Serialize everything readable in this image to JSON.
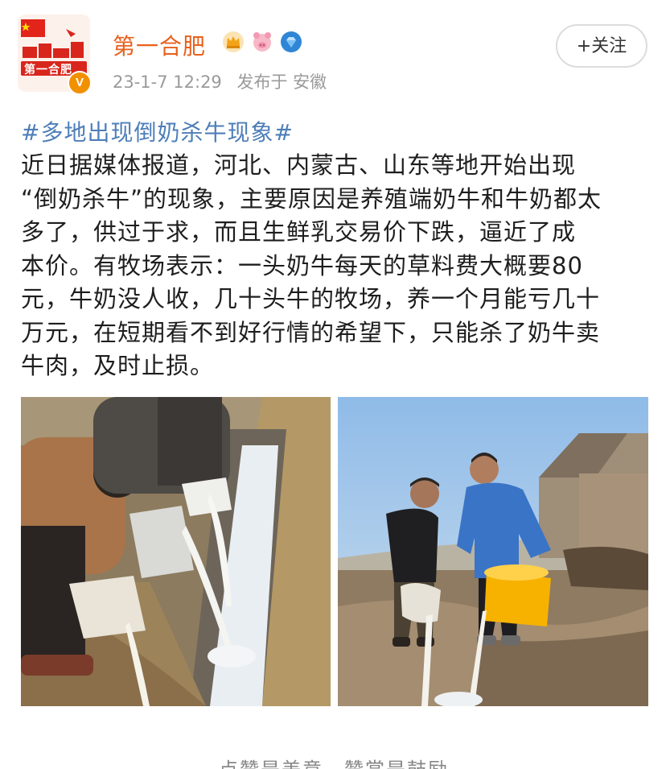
{
  "post": {
    "author": "第一合肥",
    "avatar_text": "第一合肥",
    "verified_mark": "V",
    "badges": [
      "crown-badge-icon",
      "pig-badge-icon",
      "diamond-badge-icon"
    ],
    "time": "23-1-7 12:29",
    "source": "发布于 安徽",
    "follow_label": "+关注",
    "hashtag": "#多地出现倒奶杀牛现象#",
    "body_lines": [
      "近日据媒体报道，河北、内蒙古、山东等地开始出现",
      "“倒奶杀牛”的现象，主要原因是养殖端奶牛和牛奶都太",
      "多了，供过于求，而且生鲜乳交易价下跌，逼近了成",
      "本价。有牧场表示：一头奶牛每天的草料费大概要80",
      "元，牛奶没人收，几十头牛的牧场，养一个月能亏几十",
      "万元，在短期看不到好行情的希望下，只能杀了奶牛卖",
      "牛肉，及时止损。"
    ],
    "footer_text": "点赞是美意，赞赏是鼓励"
  },
  "colors": {
    "author": "#e8601d",
    "hashtag": "#4e7eb8",
    "meta": "#9a9a9a",
    "verified": "#f29100"
  }
}
